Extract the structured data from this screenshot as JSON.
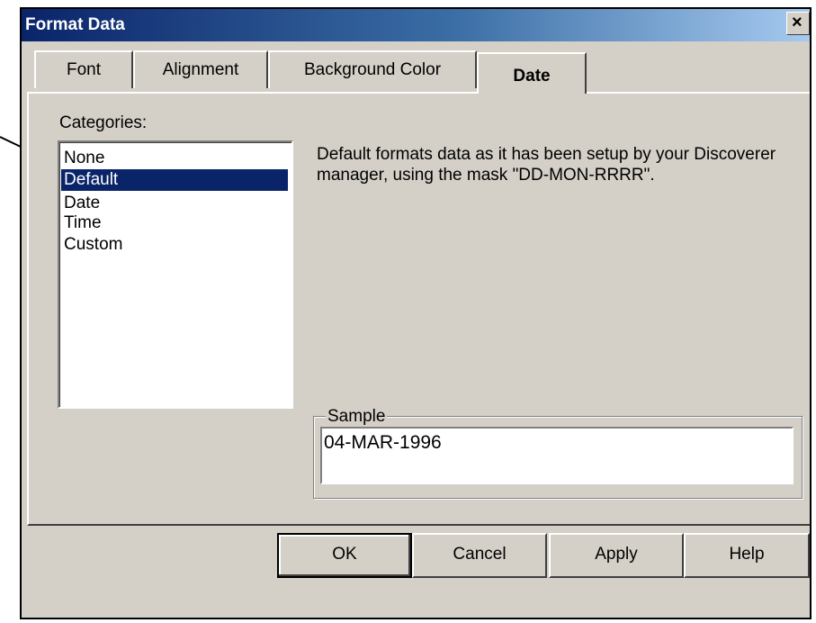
{
  "window": {
    "title": "Format Data",
    "close_glyph": "✕"
  },
  "tabs": [
    {
      "label": "Font"
    },
    {
      "label": "Alignment"
    },
    {
      "label": "Background Color"
    },
    {
      "label": "Date",
      "active": true
    }
  ],
  "categories": {
    "label": "Categories:",
    "items": [
      "None",
      "Default",
      "Date",
      "Time",
      "Custom"
    ],
    "selected": "Default"
  },
  "description": "Default formats data as it has been setup by your Discoverer manager, using the mask \"DD-MON-RRRR\".",
  "sample": {
    "label": "Sample",
    "value": "04-MAR-1996"
  },
  "buttons": {
    "ok": "OK",
    "cancel": "Cancel",
    "apply": "Apply",
    "help": "Help"
  },
  "colors": {
    "dialog_bg": "#d4d0c8",
    "title_gradient_start": "#0a246a",
    "selection": "#0a246a"
  }
}
